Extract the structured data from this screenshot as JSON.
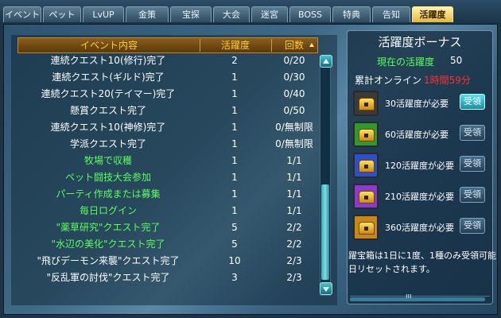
{
  "tabs": [
    {
      "label": "イベント",
      "active": false
    },
    {
      "label": "ペット",
      "active": false
    },
    {
      "label": "LvUP",
      "active": false
    },
    {
      "label": "金策",
      "active": false
    },
    {
      "label": "宝探",
      "active": false
    },
    {
      "label": "大会",
      "active": false
    },
    {
      "label": "迷宮",
      "active": false
    },
    {
      "label": "BOSS",
      "active": false
    },
    {
      "label": "特典",
      "active": false
    },
    {
      "label": "告知",
      "active": false
    },
    {
      "label": "活躍度",
      "active": true
    }
  ],
  "table": {
    "headers": {
      "event": "イベント内容",
      "points": "活躍度",
      "count": "回数"
    },
    "rows": [
      {
        "event": "連続クエスト10(修行)完了",
        "points": "2",
        "count": "0/20",
        "highlight": false
      },
      {
        "event": "連続クエスト(ギルド)完了",
        "points": "1",
        "count": "0/30",
        "highlight": false
      },
      {
        "event": "連続クエスト20(テイマー)完了",
        "points": "1",
        "count": "0/40",
        "highlight": false
      },
      {
        "event": "懸賞クエスト完了",
        "points": "1",
        "count": "0/50",
        "highlight": false
      },
      {
        "event": "連続クエスト10(神修)完了",
        "points": "1",
        "count": "0/無制限",
        "highlight": false
      },
      {
        "event": "学派クエスト完了",
        "points": "1",
        "count": "0/無制限",
        "highlight": false
      },
      {
        "event": "牧場で収穫",
        "points": "1",
        "count": "1/1",
        "highlight": true
      },
      {
        "event": "ペット闘技大会参加",
        "points": "1",
        "count": "1/1",
        "highlight": true
      },
      {
        "event": "パーティ作成または募集",
        "points": "1",
        "count": "1/1",
        "highlight": true
      },
      {
        "event": "毎日ログイン",
        "points": "1",
        "count": "1/1",
        "highlight": true
      },
      {
        "event": "\"薬草研究\"クエスト完了",
        "points": "5",
        "count": "2/2",
        "highlight": true
      },
      {
        "event": "\"水辺の美化\"クエスト完了",
        "points": "5",
        "count": "2/2",
        "highlight": true
      },
      {
        "event": "\"飛びデーモン来襲\"クエスト完了",
        "points": "10",
        "count": "2/3",
        "highlight": false
      },
      {
        "event": "\"反乱軍の討伐\"クエスト完了",
        "points": "3",
        "count": "2/3",
        "highlight": false
      }
    ]
  },
  "bonus": {
    "title": "活躍度ボーナス",
    "current_label": "現在の活躍度",
    "current_value": "50",
    "online_label": "累計オンライン",
    "online_value": "1時間59分",
    "rewards": [
      {
        "label": "30活躍度が必要",
        "button": "受領",
        "ready": true,
        "chest_color": "#3a3a3a"
      },
      {
        "label": "60活躍度が必要",
        "button": "受領",
        "ready": false,
        "chest_color": "#2e9a2e"
      },
      {
        "label": "120活躍度が必要",
        "button": "受領",
        "ready": false,
        "chest_color": "#2a4fcf"
      },
      {
        "label": "210活躍度が必要",
        "button": "受領",
        "ready": false,
        "chest_color": "#8a3ad0"
      },
      {
        "label": "360活躍度が必要",
        "button": "受領",
        "ready": false,
        "chest_color": "#c9871a"
      }
    ],
    "note_line1": "躍宝箱は1日に1度、1種のみ受領可能",
    "note_line2": "日リセットされます。",
    "scroll_grip": "ııı"
  }
}
